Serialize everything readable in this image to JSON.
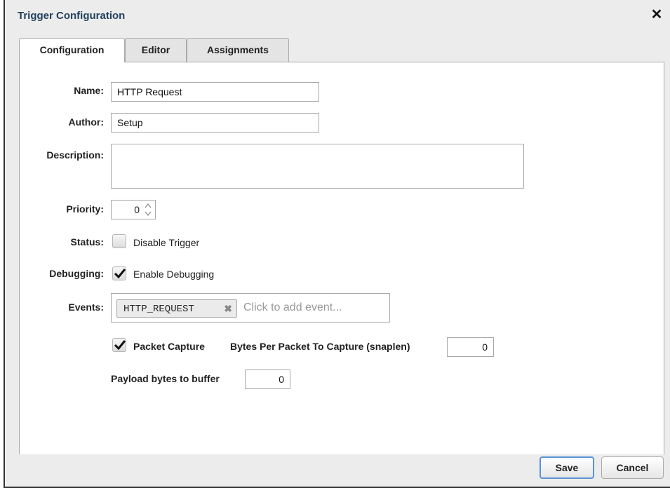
{
  "dialog": {
    "title": "Trigger Configuration",
    "close_glyph": "✕"
  },
  "tabs": [
    {
      "label": "Configuration",
      "active": true
    },
    {
      "label": "Editor",
      "active": false
    },
    {
      "label": "Assignments",
      "active": false
    }
  ],
  "form": {
    "name_label": "Name:",
    "name_value": "HTTP Request",
    "author_label": "Author:",
    "author_value": "Setup",
    "description_label": "Description:",
    "description_value": "",
    "priority_label": "Priority:",
    "priority_value": "0",
    "status_label": "Status:",
    "status_checkbox_label": "Disable Trigger",
    "status_checked": false,
    "debugging_label": "Debugging:",
    "debugging_checkbox_label": "Enable Debugging",
    "debugging_checked": true,
    "events_label": "Events:",
    "events": [
      "HTTP_REQUEST"
    ],
    "events_remove_glyph": "✖",
    "events_placeholder": "Click to add event...",
    "packet_capture_label": "Packet Capture",
    "packet_capture_checked": true,
    "snaplen_label": "Bytes Per Packet To Capture (snaplen)",
    "snaplen_value": "0",
    "payload_label": "Payload bytes to buffer",
    "payload_value": "0"
  },
  "buttons": {
    "save_label": "Save",
    "cancel_label": "Cancel"
  },
  "colors": {
    "title_color": "#23415e",
    "save_focus_border": "#5b93d6"
  }
}
